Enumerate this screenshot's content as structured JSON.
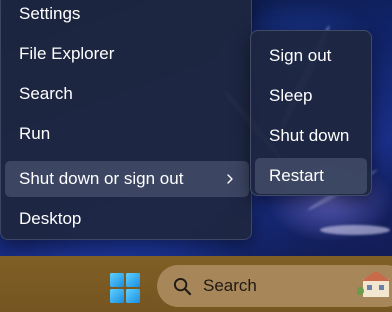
{
  "power_menu": {
    "items": [
      {
        "label": "Settings"
      },
      {
        "label": "File Explorer"
      },
      {
        "label": "Search"
      },
      {
        "label": "Run"
      },
      {
        "label": "Shut down or sign out",
        "has_submenu": true,
        "active": true
      },
      {
        "label": "Desktop"
      }
    ]
  },
  "shutdown_submenu": {
    "items": [
      {
        "label": "Sign out"
      },
      {
        "label": "Sleep"
      },
      {
        "label": "Shut down"
      },
      {
        "label": "Restart",
        "active": true
      }
    ]
  },
  "taskbar": {
    "search_label": "Search",
    "start_icon": "windows-logo",
    "search_icon": "magnifier"
  },
  "colors": {
    "menu_bg": "#1e2740",
    "menu_hover": "#424c68",
    "taskbar_bg": "#7a5a22",
    "search_box_bg": "#a7865a",
    "windows_logo_blue": "#2fa8f0"
  }
}
